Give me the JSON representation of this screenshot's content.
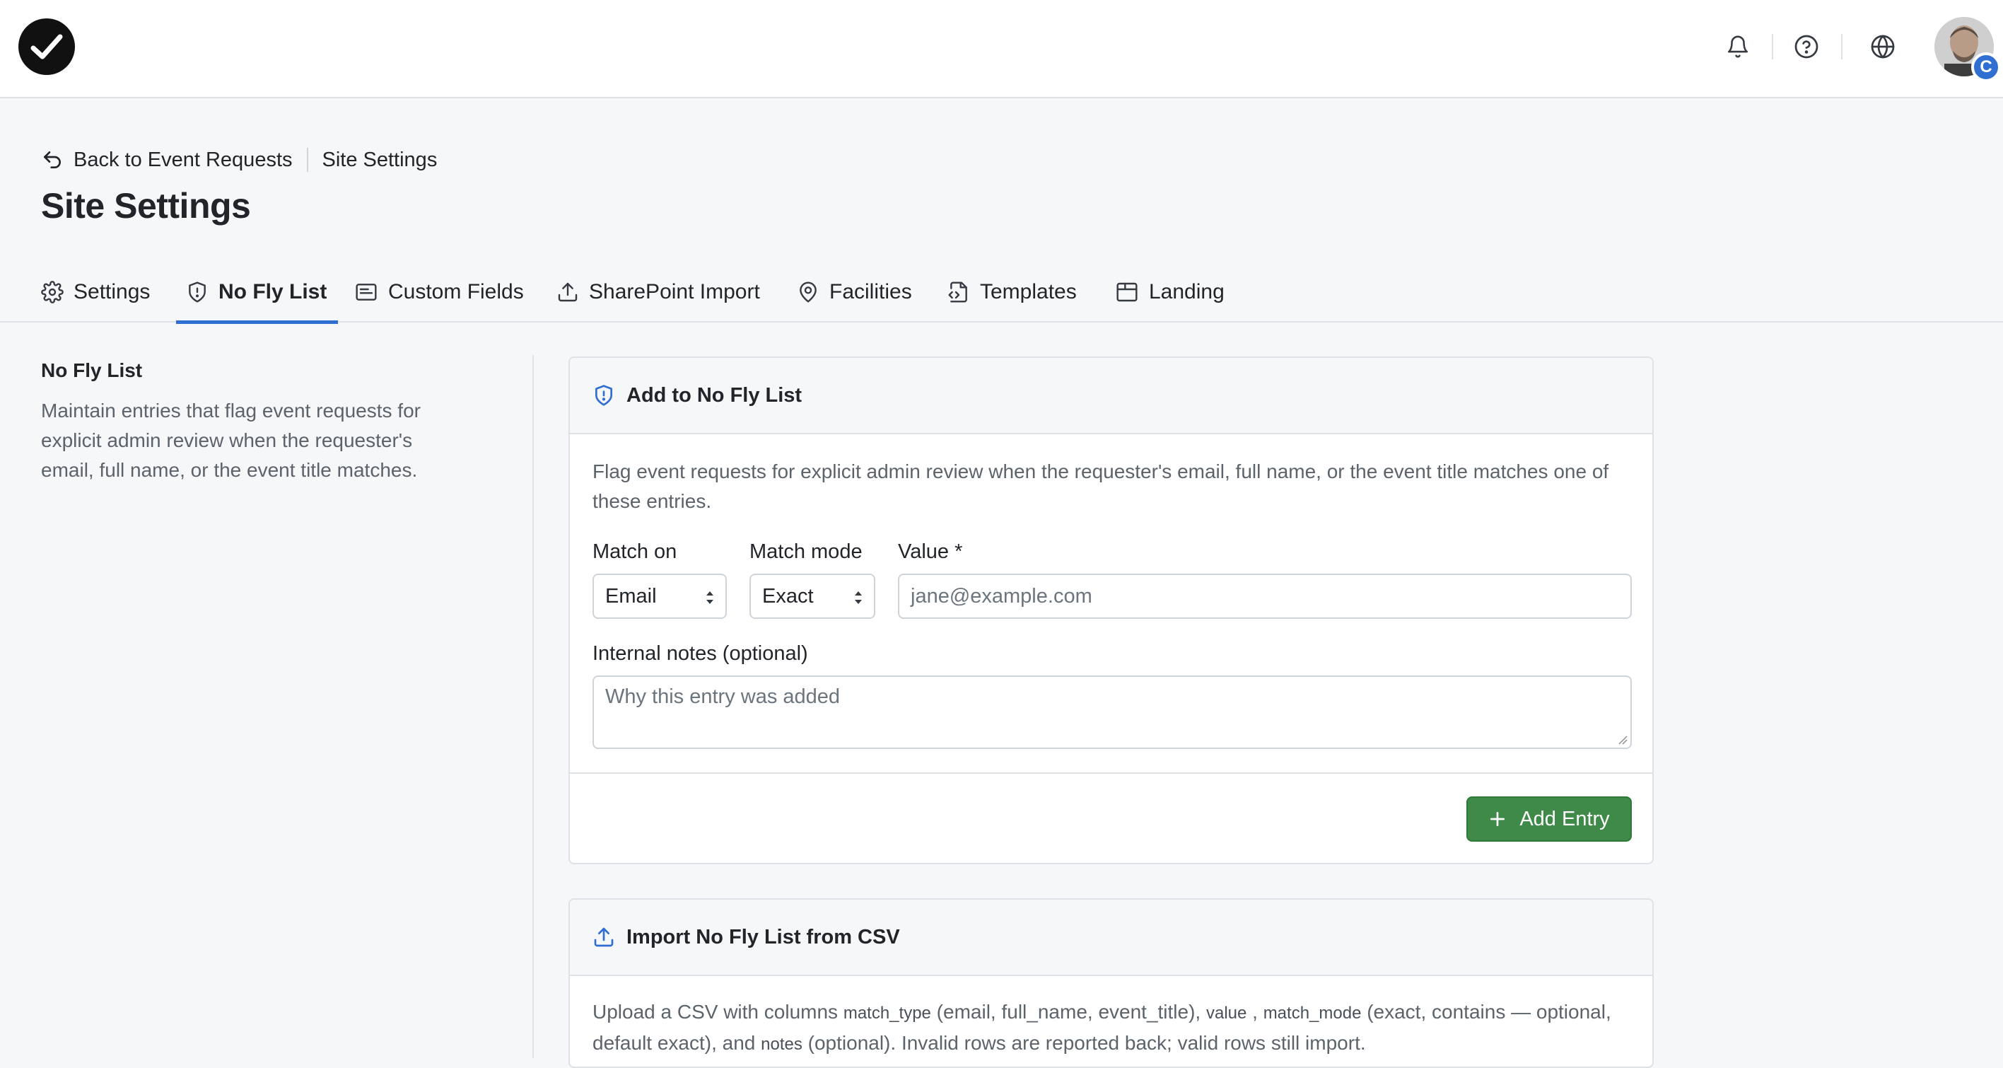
{
  "header": {
    "logo_icon": "check-circle-logo",
    "notifications_icon": "bell-icon",
    "help_icon": "help-circle-icon",
    "language_icon": "globe-icon",
    "avatar_badge": "C"
  },
  "breadcrumb": {
    "back_label": "Back to Event Requests",
    "current": "Site Settings"
  },
  "page_title": "Site Settings",
  "tabs": [
    {
      "label": "Settings",
      "icon": "gear-icon"
    },
    {
      "label": "No Fly List",
      "icon": "shield-alert-icon",
      "active": true
    },
    {
      "label": "Custom Fields",
      "icon": "form-fields-icon"
    },
    {
      "label": "SharePoint Import",
      "icon": "upload-icon"
    },
    {
      "label": "Facilities",
      "icon": "map-pin-icon"
    },
    {
      "label": "Templates",
      "icon": "file-code-icon"
    },
    {
      "label": "Landing",
      "icon": "browser-window-icon"
    }
  ],
  "sidebar": {
    "title": "No Fly List",
    "description": "Maintain entries that flag event requests for explicit admin review when the requester's email, full name, or the event title matches."
  },
  "add_card": {
    "title": "Add to No Fly List",
    "description": "Flag event requests for explicit admin review when the requester's email, full name, or the event title matches one of these entries.",
    "match_on_label": "Match on",
    "match_on_value": "Email",
    "match_mode_label": "Match mode",
    "match_mode_value": "Exact",
    "value_label": "Value *",
    "value_placeholder": "jane@example.com",
    "notes_label": "Internal notes (optional)",
    "notes_placeholder": "Why this entry was added",
    "add_button": "Add Entry"
  },
  "import_card": {
    "title": "Import No Fly List from CSV",
    "text_1": "Upload a CSV with columns ",
    "code_match_type": "match_type",
    "text_2": " (email, full_name, event_title), ",
    "code_value": "value",
    "text_3": " , ",
    "code_match_mode": "match_mode",
    "text_4": " (exact, contains — optional, default exact), and ",
    "code_notes": "notes",
    "text_5": " (optional). Invalid rows are reported back; valid rows still import."
  },
  "colors": {
    "accent": "#2f6fd1",
    "success": "#3f8a48",
    "background": "#f6f7f9"
  }
}
